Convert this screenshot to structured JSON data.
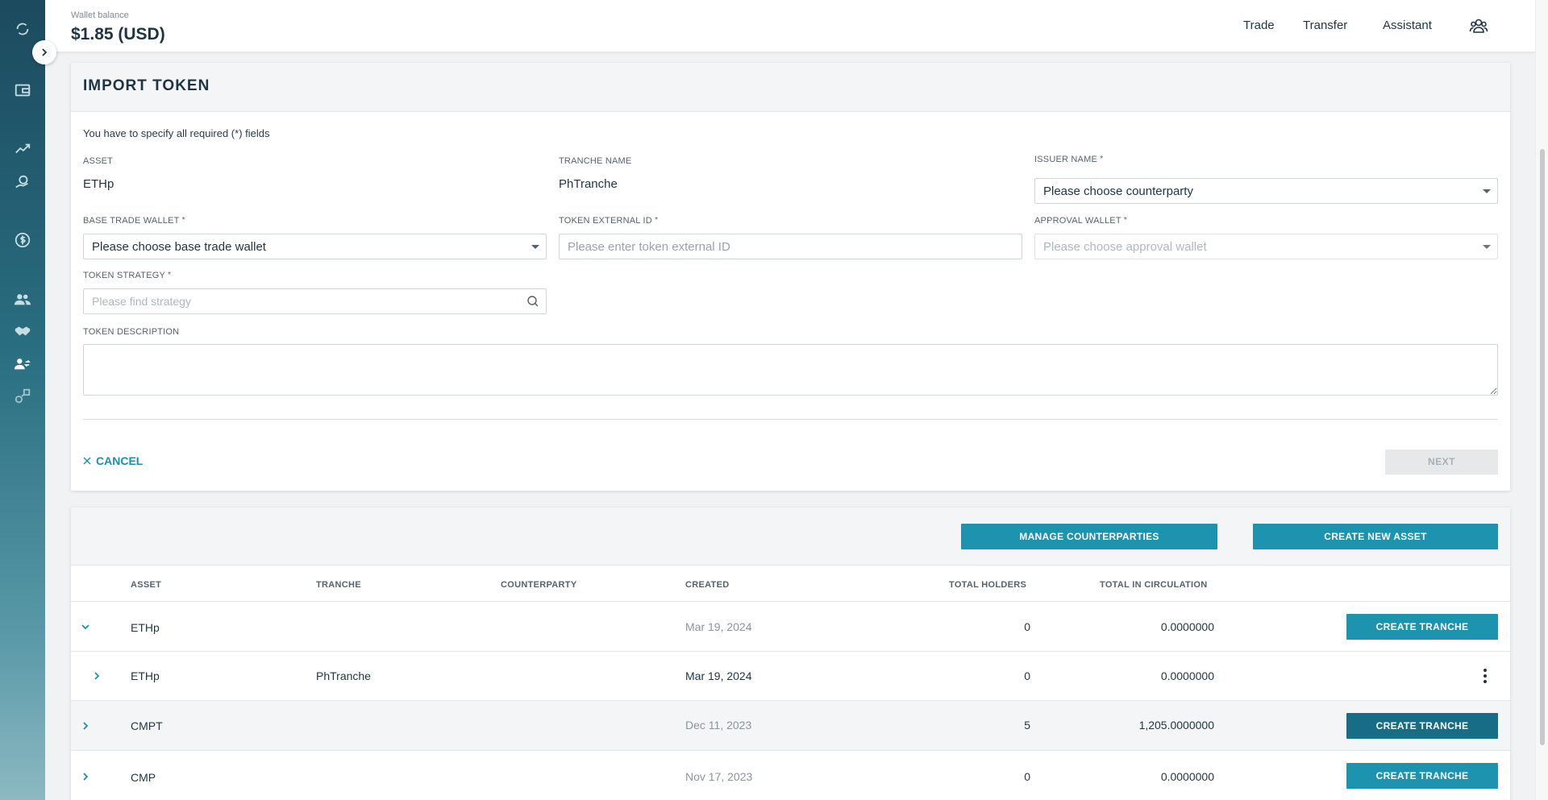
{
  "header": {
    "wallet_label": "Wallet balance",
    "wallet_value": "$1.85 (USD)",
    "nav": [
      "Trade",
      "Transfer",
      "Assistant"
    ]
  },
  "sidebar": {
    "icons": [
      "sync-icon",
      "wallet-icon",
      "chart-trend-icon",
      "money-hand-icon",
      "dollar-icon",
      "users-icon",
      "handshake-icon",
      "user-transfer-icon",
      "tokens-icon"
    ]
  },
  "import_token": {
    "title": "IMPORT TOKEN",
    "hint": "You have to specify all required (*) fields",
    "asset_label": "ASSET",
    "asset_value": "ETHp",
    "tranche_label": "TRANCHE NAME",
    "tranche_value": "PhTranche",
    "issuer_label": "ISSUER NAME",
    "issuer_value": "Please choose counterparty",
    "base_wallet_label": "BASE TRADE WALLET",
    "base_wallet_value": "Please choose base trade wallet",
    "external_id_label": "TOKEN EXTERNAL ID",
    "external_id_placeholder": "Please enter token external ID",
    "approval_wallet_label": "APPROVAL WALLET",
    "approval_wallet_value": "Please choose approval wallet",
    "strategy_label": "TOKEN STRATEGY",
    "strategy_placeholder": "Please find strategy",
    "description_label": "TOKEN DESCRIPTION",
    "description_value": "",
    "required_mark": "*",
    "cancel_label": "CANCEL",
    "next_label": "NEXT"
  },
  "table": {
    "manage_label": "MANAGE COUNTERPARTIES",
    "create_asset_label": "CREATE NEW ASSET",
    "columns": [
      "ASSET",
      "TRANCHE",
      "COUNTERPARTY",
      "CREATED",
      "TOTAL HOLDERS",
      "TOTAL IN CIRCULATION"
    ],
    "rows": [
      {
        "asset": "ETHp",
        "tranche": "",
        "counterparty": "",
        "created": "Mar 19, 2024",
        "holders": "0",
        "circulation": "0.0000000",
        "action": "CREATE TRANCHE",
        "expanded": true
      },
      {
        "asset": "ETHp",
        "tranche": "PhTranche",
        "counterparty": "",
        "created": "Mar 19, 2024",
        "holders": "0",
        "circulation": "0.0000000",
        "action": "",
        "expanded": false
      },
      {
        "asset": "CMPT",
        "tranche": "",
        "counterparty": "",
        "created": "Dec 11, 2023",
        "holders": "5",
        "circulation": "1,205.0000000",
        "action": "CREATE TRANCHE",
        "expanded": false
      },
      {
        "asset": "CMP",
        "tranche": "",
        "counterparty": "",
        "created": "Nov 17, 2023",
        "holders": "0",
        "circulation": "0.0000000",
        "action": "CREATE TRANCHE",
        "expanded": false
      }
    ]
  },
  "colors": {
    "accent": "#1d93b0",
    "accent_dark": "#176d85",
    "text": "#1f3442"
  }
}
